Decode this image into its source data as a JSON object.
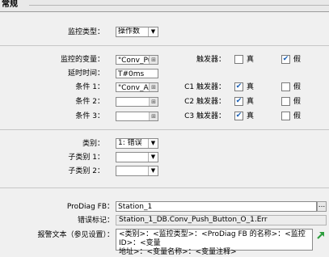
{
  "section": {
    "title": "常规"
  },
  "monitor_type": {
    "label": "监控类型：",
    "value": "操作数"
  },
  "monitored_var": {
    "label": "监控的变量：",
    "value": "\"Conv_Pus"
  },
  "trigger": {
    "label": "触发器：",
    "true_label": "真",
    "false_label": "假",
    "true_checked": false,
    "false_checked": true
  },
  "delay": {
    "label": "延时时间：",
    "value": "T#0ms"
  },
  "conditions": [
    {
      "label": "条件 1：",
      "value": "\"Conv_Act",
      "trig_label": "C1 触发器：",
      "true_label": "真",
      "false_label": "假",
      "true_checked": true,
      "false_checked": false
    },
    {
      "label": "条件 2：",
      "value": "",
      "trig_label": "C2 触发器：",
      "true_label": "真",
      "false_label": "假",
      "true_checked": true,
      "false_checked": false
    },
    {
      "label": "条件 3：",
      "value": "",
      "trig_label": "C3 触发器：",
      "true_label": "真",
      "false_label": "假",
      "true_checked": true,
      "false_checked": false
    }
  ],
  "category": {
    "label": "类别：",
    "value": "1: 错误"
  },
  "subcat1": {
    "label": "子类别 1：",
    "value": ""
  },
  "subcat2": {
    "label": "子类别 2：",
    "value": ""
  },
  "prodiag_fb": {
    "label": "ProDiag FB：",
    "value": "Station_1",
    "browse": "..."
  },
  "error_tag": {
    "label": "错误标记：",
    "value": "Station_1_DB.Conv_Push_Button_O_1.Err"
  },
  "alarm_text": {
    "label": "报警文本（参见设置）：",
    "line1": "<类别>：<监控类型>：<ProDiag FB 的名称>：<监控 ID>：<变量",
    "line2": "地址>：<变量名称>：<变量注释>"
  },
  "icons": {
    "dropdown": "chevron-down-icon",
    "tag_browse": "tag-browse-icon",
    "link": "arrow-up-right-icon"
  },
  "colors": {
    "check": "#1a5fb4",
    "link_arrow": "#2e9e3e"
  }
}
